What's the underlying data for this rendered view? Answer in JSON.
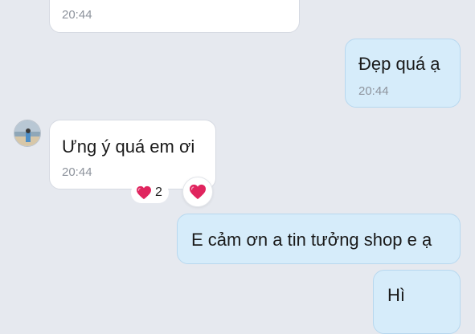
{
  "messages": [
    {
      "id": "m1",
      "direction": "incoming",
      "text": "",
      "time": "20:44"
    },
    {
      "id": "m2",
      "direction": "outgoing",
      "text": "Đẹp quá ạ",
      "time": "20:44"
    },
    {
      "id": "m3",
      "direction": "incoming",
      "text": "Ưng ý quá em ơi",
      "time": "20:44",
      "reactions": {
        "icon": "heart-icon",
        "count": "2"
      }
    },
    {
      "id": "m4",
      "direction": "outgoing",
      "text": "E cảm ơn a tin tưởng shop e ạ"
    },
    {
      "id": "m5",
      "direction": "outgoing",
      "text": "Hì"
    }
  ],
  "react_button": {
    "icon": "heart-icon"
  },
  "colors": {
    "background": "#e6e9ef",
    "incoming_bubble": "#ffffff",
    "outgoing_bubble": "#d6ecfa",
    "heart": "#e0245e",
    "time_text": "#8d939c"
  }
}
